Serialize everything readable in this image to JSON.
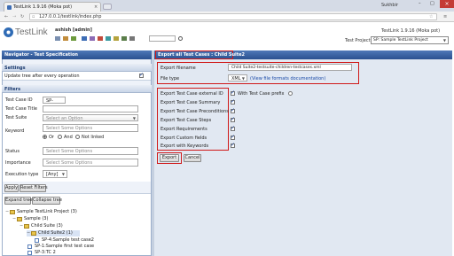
{
  "browser": {
    "tab_title": "TestLink 1.9.16 (Moka pot)",
    "url": "127.0.0.1/testlink/index.php",
    "window_label": "Sukhbir"
  },
  "app": {
    "logo": "TestLink",
    "user": "ashish [admin]",
    "version": "TestLink 1.9.16 (Moka pot)",
    "project_label": "Test Project",
    "project_value": "SP: Sample TestLink Project"
  },
  "left": {
    "navigator_title": "Navigator - Test Specification",
    "settings": {
      "title": "Settings",
      "update_tree_label": "Update tree after every operation"
    },
    "filters": {
      "title": "Filters",
      "tc_id_label": "Test Case ID",
      "tc_id_value": "SP-",
      "tc_title_label": "Test Case Title",
      "test_suite_label": "Test Suite",
      "test_suite_placeholder": "Select an Option",
      "keyword_label": "Keyword",
      "keyword_placeholder": "Select Some Options",
      "or_label": "Or",
      "and_label": "And",
      "not_linked_label": "Not linked",
      "status_label": "Status",
      "status_placeholder": "Select Some Options",
      "importance_label": "Importance",
      "importance_placeholder": "Select Some Options",
      "execution_type_label": "Execution type",
      "execution_type_value": "[Any]",
      "apply_label": "Apply",
      "reset_label": "Reset Filters"
    },
    "tree": {
      "expand_label": "Expand tree",
      "collapse_label": "Collapse tree",
      "items": [
        "Sample TestLink Project (3)",
        "Sample (3)",
        "Child Suite (3)",
        "Child Suite2 (1)",
        "SP-4:Sample test case2",
        "SP-1:Sample first test case",
        "SP-3:TC 2"
      ]
    }
  },
  "right": {
    "title": "Export all Test Cases : Child Suite2",
    "export_filename_label": "Export filename",
    "export_filename_value": "Child Suite2-testsuite-children-testcases.xml",
    "file_type_label": "File type",
    "file_type_value": "XML",
    "formats_link": "(View file formats documentation)",
    "options": [
      "Export Test Case external ID",
      "Export Test Case Summary",
      "Export Test Case Preconditions",
      "Export Test Case Steps",
      "Export Requirements",
      "Export Custom fields",
      "Export with Keywords"
    ],
    "with_prefix_label": "With Test Case prefix",
    "export_label": "Export",
    "cancel_label": "Cancel"
  },
  "colors": {
    "accent": "#2a5190",
    "highlight": "#d01818",
    "panel_bg": "#eef2f9",
    "right_bg": "#e1e8f2"
  }
}
